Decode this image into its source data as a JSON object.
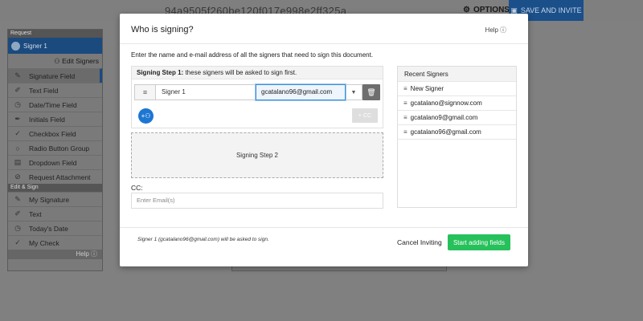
{
  "background": {
    "doc_title": "94a9505f260be120f017e998e2ff325a",
    "options_label": "OPTIONS",
    "save_invite_label": "SAVE AND INVITE",
    "sidebar": {
      "request_section": "Request",
      "signer": "Signer 1",
      "edit_signers": "Edit Signers",
      "request_items": [
        {
          "label": "Signature Field",
          "icon": "pen-nib-icon",
          "glyph": "✎"
        },
        {
          "label": "Text Field",
          "icon": "pencil-icon",
          "glyph": "✐"
        },
        {
          "label": "Date/Time Field",
          "icon": "clock-icon",
          "glyph": "◷"
        },
        {
          "label": "Initials Field",
          "icon": "pen-icon",
          "glyph": "✒"
        },
        {
          "label": "Checkbox Field",
          "icon": "check-icon",
          "glyph": "✓"
        },
        {
          "label": "Radio Button Group",
          "icon": "radio-icon",
          "glyph": "○"
        },
        {
          "label": "Dropdown Field",
          "icon": "dropdown-icon",
          "glyph": "▤"
        },
        {
          "label": "Request Attachment",
          "icon": "paperclip-icon",
          "glyph": "⊘"
        }
      ],
      "edit_section": "Edit & Sign",
      "edit_items": [
        {
          "label": "My Signature",
          "icon": "pen-nib-icon",
          "glyph": "✎"
        },
        {
          "label": "Text",
          "icon": "pencil-icon",
          "glyph": "✐"
        },
        {
          "label": "Today's Date",
          "icon": "clock-icon",
          "glyph": "◷"
        },
        {
          "label": "My Check",
          "icon": "check-icon",
          "glyph": "✓"
        }
      ],
      "help": "Help"
    }
  },
  "modal": {
    "title": "Who is signing?",
    "help": "Help",
    "instructions": "Enter the name and e-mail address of all the signers that need to sign this document.",
    "step1": {
      "title_bold": "Signing Step 1:",
      "title_rest": " these signers will be asked to sign first.",
      "signer_name": "Signer 1",
      "signer_email": "gcatalano96@gmail.com",
      "cc_button": "+ CC"
    },
    "step2_label": "Signing Step 2",
    "cc_label": "CC:",
    "cc_placeholder": "Enter Email(s)",
    "recent": {
      "title": "Recent Signers",
      "items": [
        "New Signer",
        "gcatalano@signnow.com",
        "gcatalano9@gmail.com",
        "gcatalano96@gmail.com"
      ]
    },
    "footer": {
      "note": "Signer 1 (gcatalano96@gmail.com) will be asked to sign.",
      "cancel": "Cancel Inviting",
      "start": "Start adding fields"
    }
  }
}
